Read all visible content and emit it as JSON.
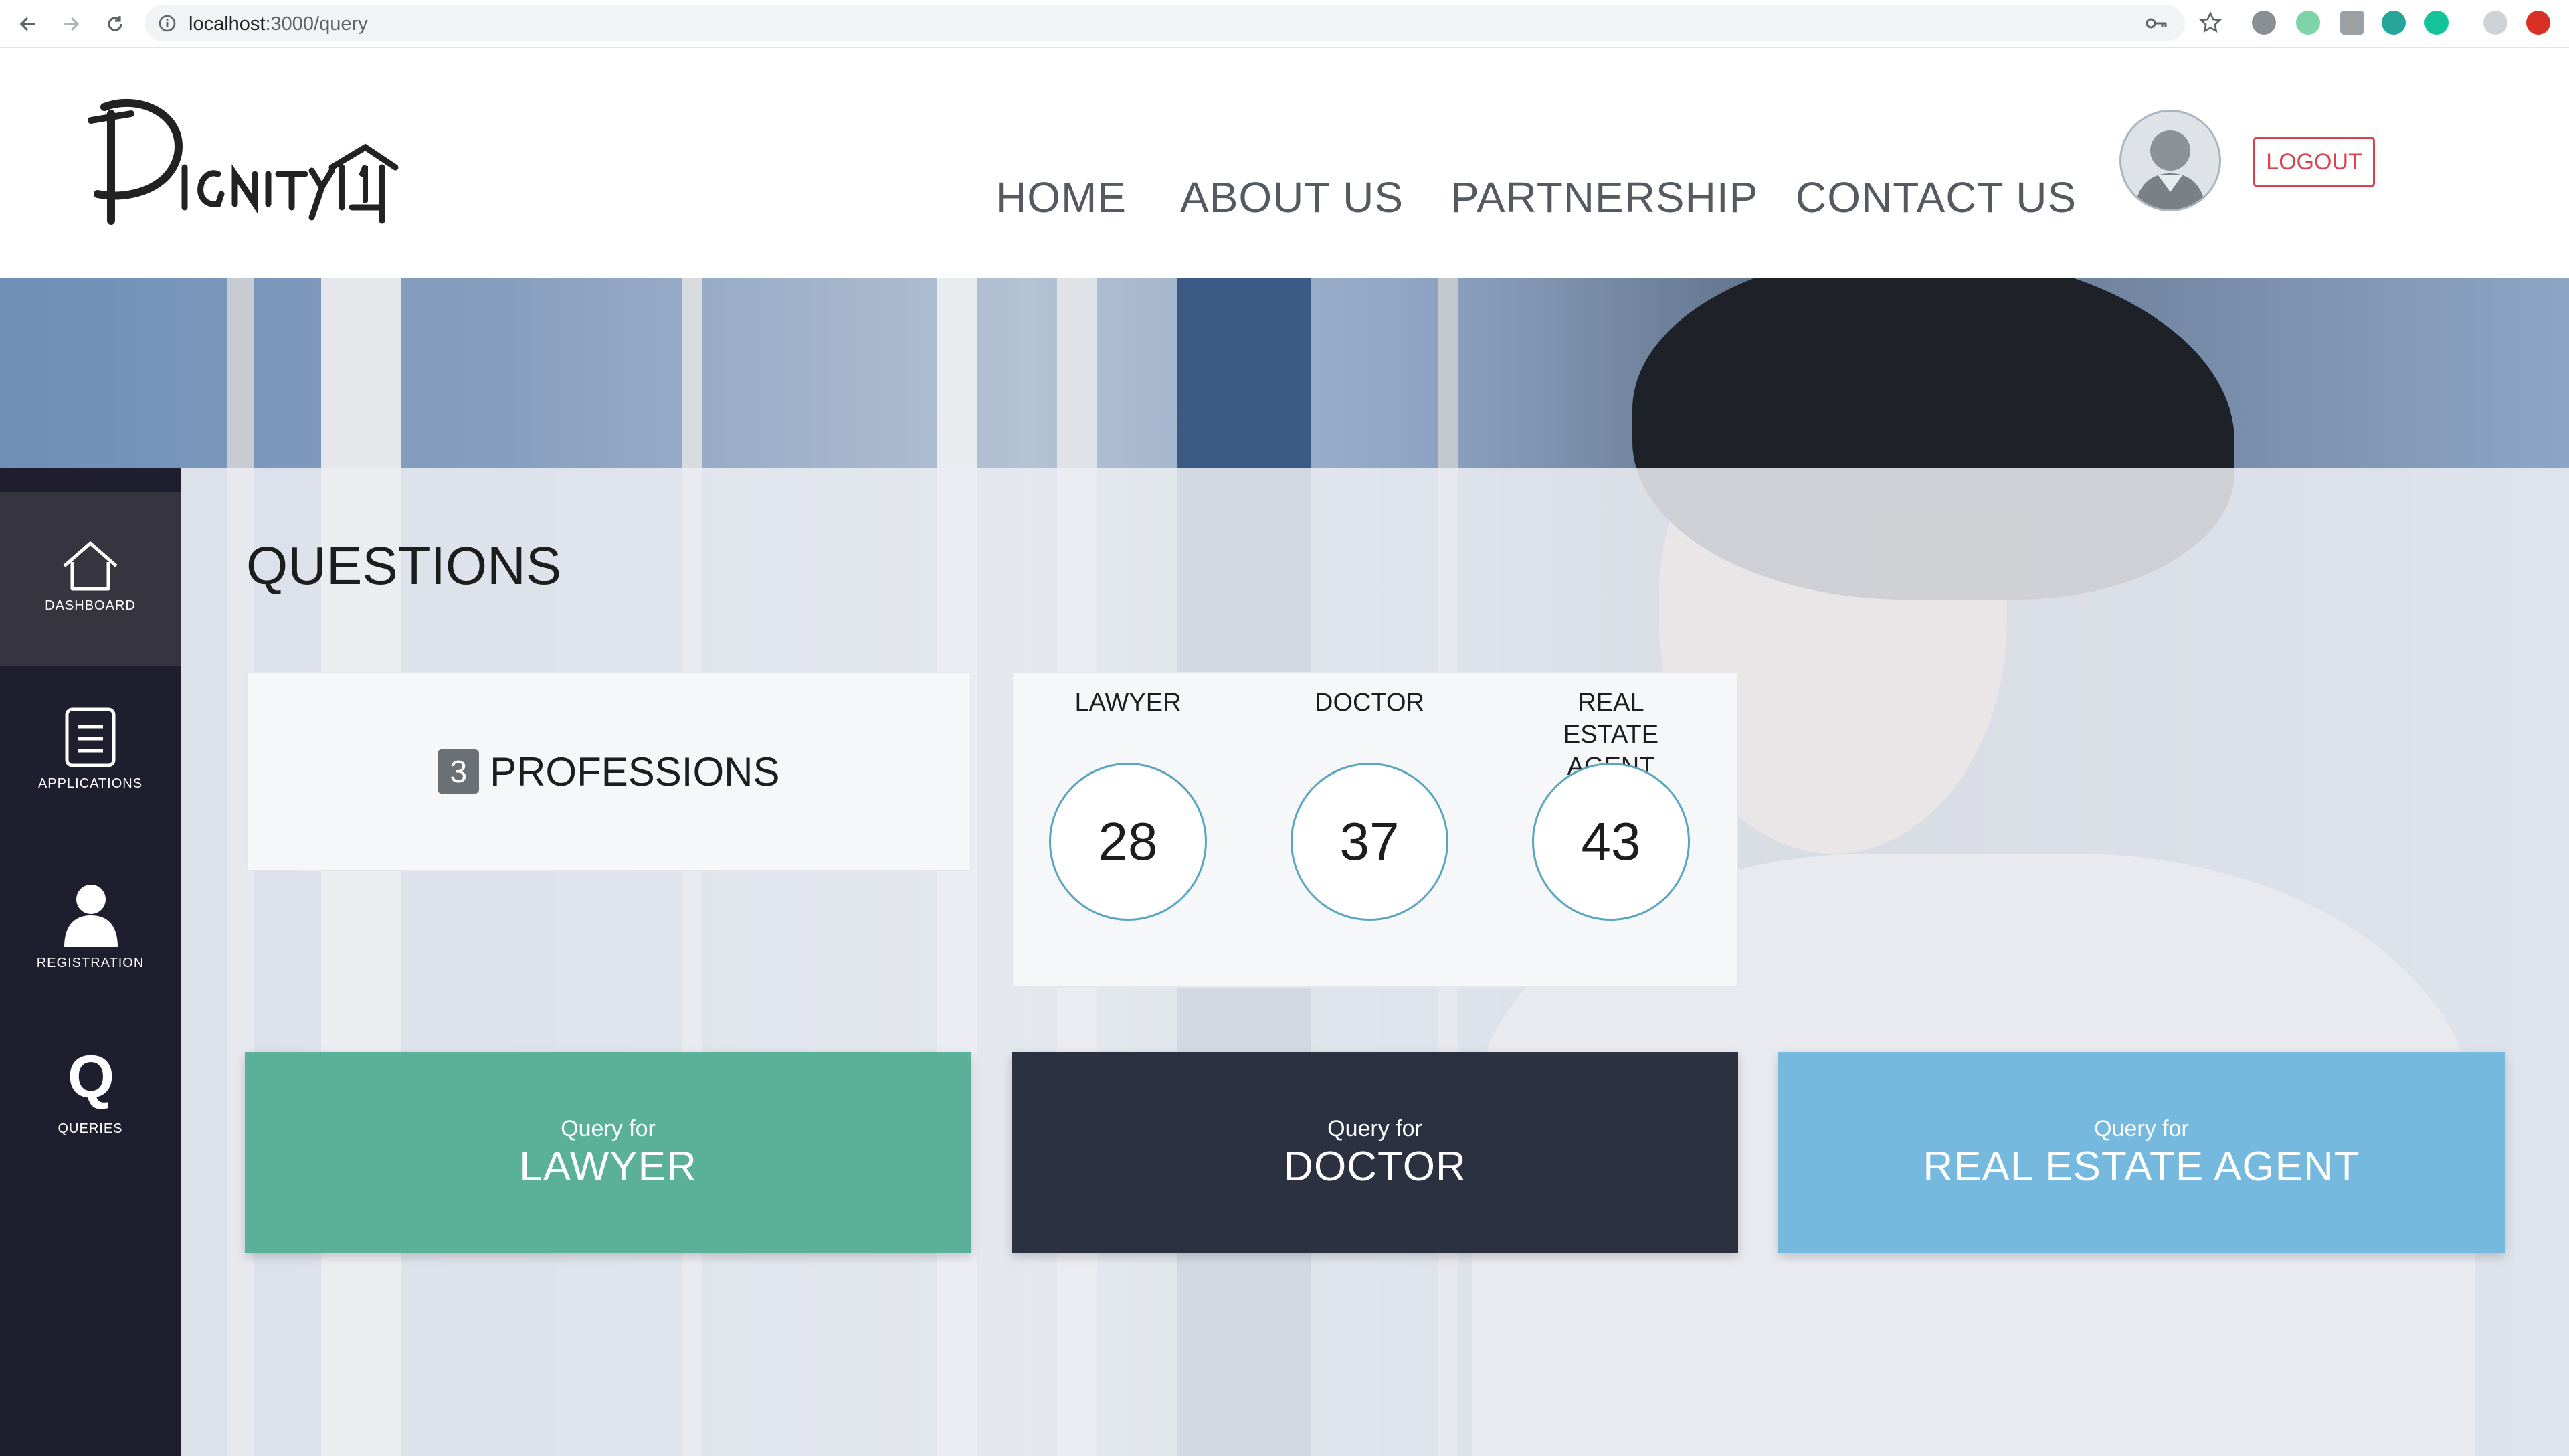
{
  "browser": {
    "url_host": "localhost",
    "url_path": ":3000/query"
  },
  "header": {
    "nav": [
      "HOME",
      "ABOUT US",
      "PARTNERSHIP",
      "CONTACT US"
    ],
    "logout_label": "LOGOUT"
  },
  "sidebar": {
    "items": [
      {
        "label": "DASHBOARD",
        "icon": "home-icon",
        "active": true
      },
      {
        "label": "APPLICATIONS",
        "icon": "document-icon",
        "active": false
      },
      {
        "label": "REGISTRATION",
        "icon": "user-icon",
        "active": false
      },
      {
        "label": "QUERIES",
        "icon": "q-icon",
        "active": false
      }
    ]
  },
  "main": {
    "title": "QUESTIONS",
    "professions_count": "3",
    "professions_label": "PROFESSIONS",
    "stats": [
      {
        "name": "LAWYER",
        "value": "28"
      },
      {
        "name": "DOCTOR",
        "value": "37"
      },
      {
        "name": "REAL ESTATE AGENT",
        "value": "43"
      }
    ],
    "query_buttons": [
      {
        "prefix": "Query for",
        "label": "LAWYER",
        "color": "#5bb197"
      },
      {
        "prefix": "Query for",
        "label": "DOCTOR",
        "color": "#2c3141"
      },
      {
        "prefix": "Query for",
        "label": "REAL ESTATE AGENT",
        "color": "#76b9df"
      }
    ]
  },
  "colors": {
    "sidebar_bg": "#1f1e2e",
    "accent_red": "#d9434e",
    "circle_border": "#5aa6c0"
  }
}
